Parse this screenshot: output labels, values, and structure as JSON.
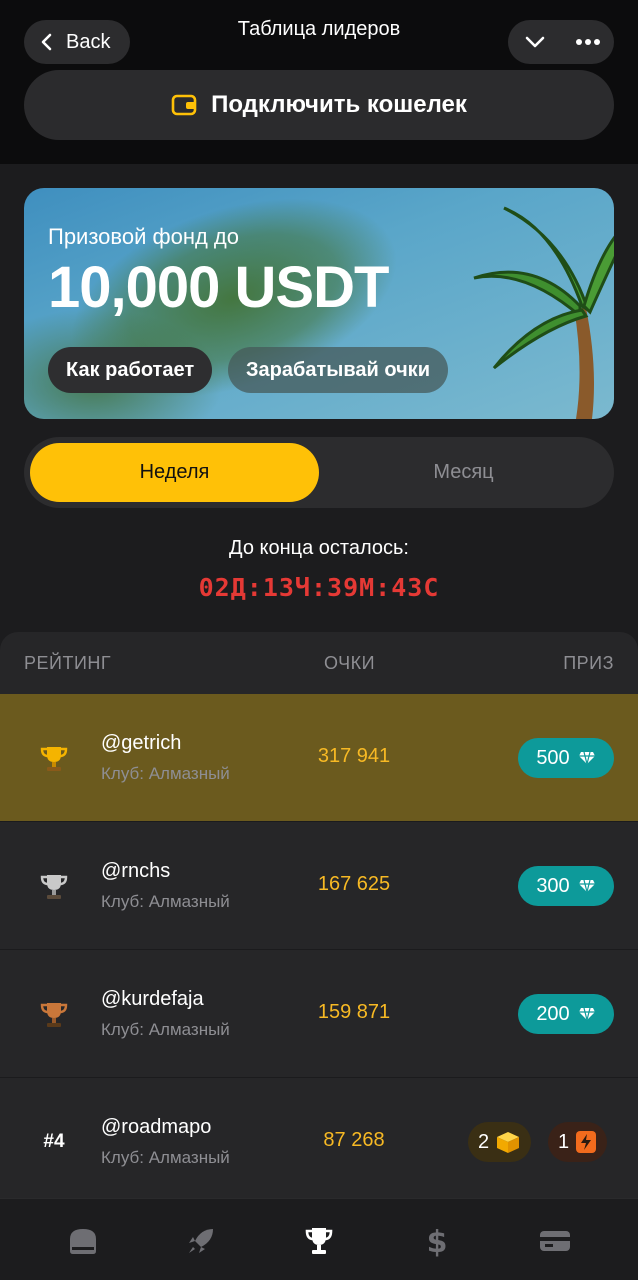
{
  "header": {
    "back_label": "Back",
    "title": "Таблица лидеров"
  },
  "wallet": {
    "label": "Подключить кошелек"
  },
  "banner": {
    "prize_label": "Призовой фонд до",
    "prize_value": "10,000 USDT",
    "how_label": "Как работает",
    "earn_label": "Зарабатывай очки"
  },
  "period": {
    "options": [
      "Неделя",
      "Месяц"
    ],
    "selected": "Неделя"
  },
  "countdown": {
    "label": "До конца осталось:",
    "value": "02Д:13Ч:39М:43С"
  },
  "table": {
    "headers": {
      "rank": "РЕЙТИНГ",
      "points": "ОЧКИ",
      "prize": "ПРИЗ"
    },
    "rows": [
      {
        "rank": "gold-trophy",
        "name": "@getrich",
        "club": "Клуб: Алмазный",
        "points": "317 941",
        "prize": "500"
      },
      {
        "rank": "silver-trophy",
        "name": "@rnchs",
        "club": "Клуб: Алмазный",
        "points": "167 625",
        "prize": "300"
      },
      {
        "rank": "bronze-trophy",
        "name": "@kurdefaja",
        "club": "Клуб: Алмазный",
        "points": "159 871",
        "prize": "200"
      },
      {
        "rank": "#4",
        "name": "@roadmapo",
        "club": "Клуб: Алмазный",
        "points": "87 268",
        "prize_box": "2",
        "prize_energy": "1"
      }
    ]
  },
  "nav": [
    "home-icon",
    "rocket-icon",
    "trophy-icon",
    "dollar-icon",
    "card-icon"
  ],
  "colors": {
    "accent": "#ffc107",
    "points": "#f7b924",
    "timer": "#e53935",
    "prize": "#0d9a9a",
    "highlight_row": "#6b5a1e"
  }
}
